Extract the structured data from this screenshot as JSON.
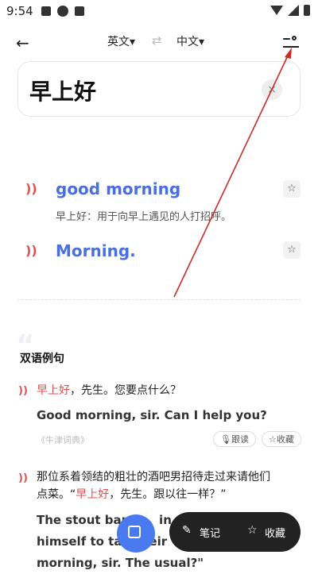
{
  "status_bar": {
    "time": "9:54"
  },
  "topbar": {
    "back_glyph": "←",
    "source_lang": "英文▾",
    "target_lang": "中文▾",
    "swap_glyph": "⇄"
  },
  "input": {
    "text": "早上好",
    "clear_glyph": "×"
  },
  "results": [
    {
      "word": "good morning",
      "definition": "早上好：用于向早上遇见的人打招呼。"
    },
    {
      "word": "Morning.",
      "definition": ""
    }
  ],
  "icons": {
    "speaker": "))",
    "star": "☆"
  },
  "examples": {
    "title": "双语例句",
    "items": [
      {
        "zh_highlight": "早上好",
        "zh_rest": "，先生。您要点什么？",
        "en": "Good morning, sir. Can I help you?",
        "source": "《牛津词典》",
        "follow_label": "跟读",
        "collect_label": "收藏"
      },
      {
        "zh_line1": "那位系着领结的粗壮的酒吧男招待走过来请他们",
        "zh_line2_pre": "点菜。“",
        "zh_line2_highlight": "早上好",
        "zh_line2_post": "，先生。跟以往一样？”",
        "en_line1": "The stout bar",
        "en_line1_tail": "in",
        "en_line2": "himself to tak",
        "en_line2_tail": "eir",
        "en_line3": "morning, sir. The usual?\""
      }
    ]
  },
  "bottom_bar": {
    "notes_label": "笔记",
    "collect_label": "收藏"
  },
  "colors": {
    "accent": "#4a6fe0",
    "highlight": "#e05050",
    "annotation": "#cc2a2a"
  }
}
